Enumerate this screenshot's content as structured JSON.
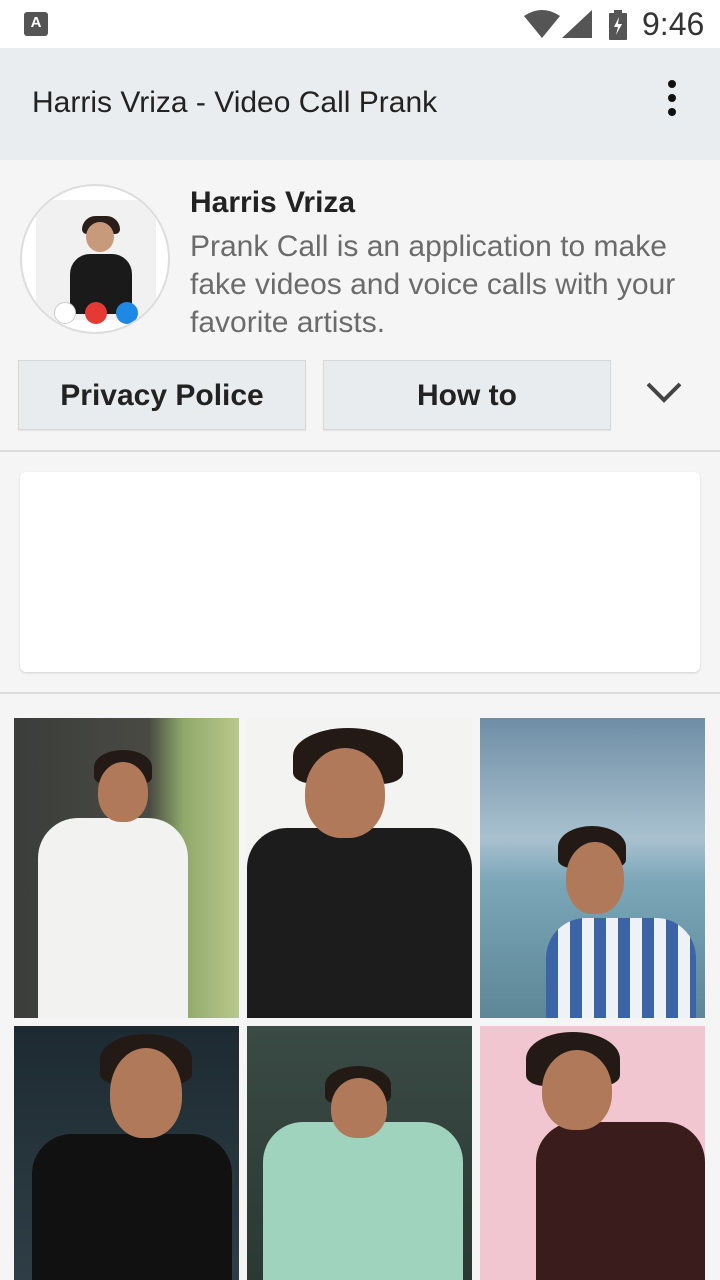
{
  "status_bar": {
    "time": "9:46",
    "notification_icon": "A",
    "icons": [
      "wifi-icon",
      "signal-icon",
      "battery-charging-icon"
    ]
  },
  "app_bar": {
    "title": "Harris Vriza - Video Call Prank",
    "menu_icon": "more-vert-icon"
  },
  "profile": {
    "name": "Harris Vriza",
    "description": "Prank Call is an application to make fake videos and voice calls with your favorite artists."
  },
  "actions": {
    "privacy_label": "Privacy Police",
    "howto_label": "How to",
    "expand_icon": "chevron-down-icon"
  },
  "colors": {
    "app_bar_bg": "#e9edf0",
    "button_bg": "#e9ecee",
    "text_primary": "#222222",
    "text_secondary": "#6b6b6b"
  },
  "gallery": {
    "photos": [
      "photo-1",
      "photo-2",
      "photo-3",
      "photo-4",
      "photo-5",
      "photo-6"
    ]
  }
}
